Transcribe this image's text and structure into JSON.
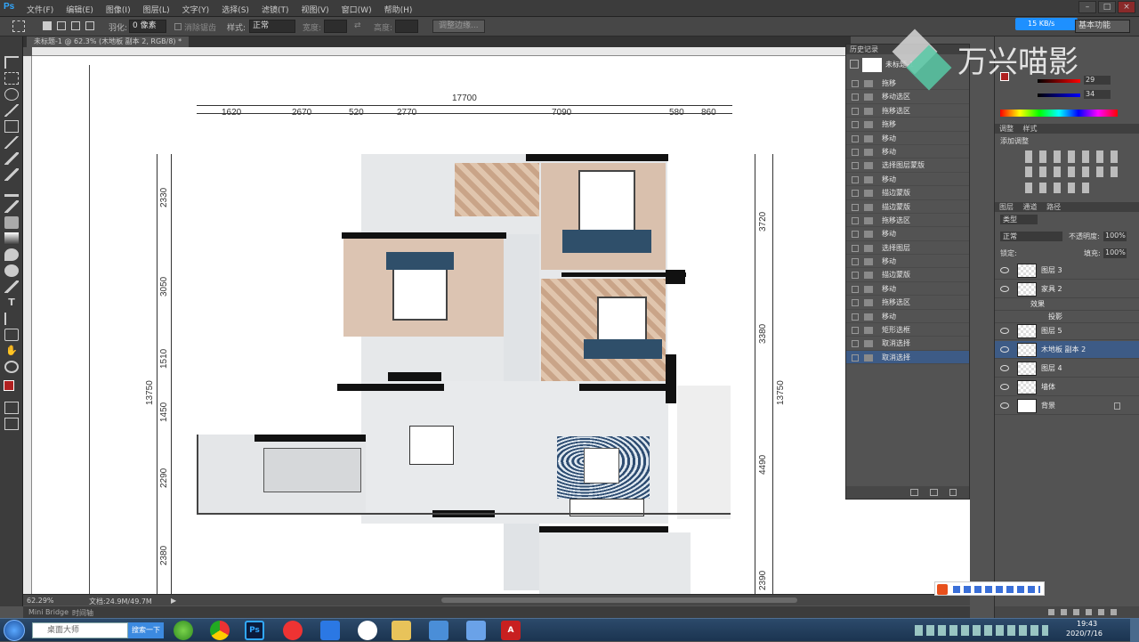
{
  "app": {
    "logo": "Ps"
  },
  "menubar": {
    "items": [
      "文件(F)",
      "编辑(E)",
      "图像(I)",
      "图层(L)",
      "文字(Y)",
      "选择(S)",
      "滤镜(T)",
      "视图(V)",
      "窗口(W)",
      "帮助(H)"
    ]
  },
  "options": {
    "feather_label": "羽化:",
    "feather_value": "0 像素",
    "antialias_label": "消除锯齿",
    "style_label": "样式:",
    "style_value": "正常",
    "width_label": "宽度:",
    "height_label": "高度:",
    "refine_button": "调整边缘...",
    "speed": "15 KB/s",
    "workspace": "基本功能"
  },
  "document": {
    "tab_title": "未标题-1 @ 62.3% (木地板 副本 2, RGB/8) *",
    "zoom": "62.29%",
    "doc_info": "文档:24.9M/49.7M"
  },
  "floorplan": {
    "top_total": "17700",
    "top_dims": [
      "1620",
      "2670",
      "520",
      "2770",
      "7090",
      "580",
      "860"
    ],
    "left_dims": [
      "2330",
      "3050",
      "1510",
      "1450",
      "2290",
      "2380"
    ],
    "left_total": "13750",
    "right_dims": [
      "3720",
      "3380",
      "4490",
      "2390"
    ],
    "right_total": "13750"
  },
  "history": {
    "title": "历史记录",
    "snapshot": "未标题-1",
    "rows": [
      "拖移",
      "移动选区",
      "拖移选区",
      "拖移",
      "移动",
      "移动",
      "选择图层蒙版",
      "移动",
      "描边蒙版",
      "描边蒙版",
      "拖移选区",
      "移动",
      "选择图层",
      "移动",
      "描边蒙版",
      "移动",
      "拖移选区",
      "移动",
      "矩形选框",
      "取消选择",
      "取消选择"
    ]
  },
  "watermark": {
    "text": "万兴喵影"
  },
  "color_panel": {
    "r": "29",
    "g": "29",
    "b": "34"
  },
  "adjustments": {
    "tabs": [
      "调整",
      "样式"
    ],
    "title": "添加调整"
  },
  "layers": {
    "tabs": [
      "图层",
      "通道",
      "路径"
    ],
    "kind_label": "类型",
    "blend_mode": "正常",
    "opacity_label": "不透明度:",
    "opacity_value": "100%",
    "lock_label": "锁定:",
    "fill_label": "填充:",
    "fill_value": "100%",
    "items": [
      "图层 3",
      "家具 2",
      "效果",
      "投影",
      "图层 5",
      "木地板 副本 2",
      "图层 4",
      "墙体",
      "背景"
    ]
  },
  "minibridge": {
    "labels": [
      "Mini Bridge",
      "时间轴"
    ]
  },
  "taskbar": {
    "search_placeholder": "桌面大师",
    "search_button": "搜索一下",
    "time": "19:43",
    "date": "2020/7/16"
  },
  "colors": {
    "accent": "#3d5b86",
    "ps_blue": "#31a8ff",
    "foreground": "#b02020"
  }
}
